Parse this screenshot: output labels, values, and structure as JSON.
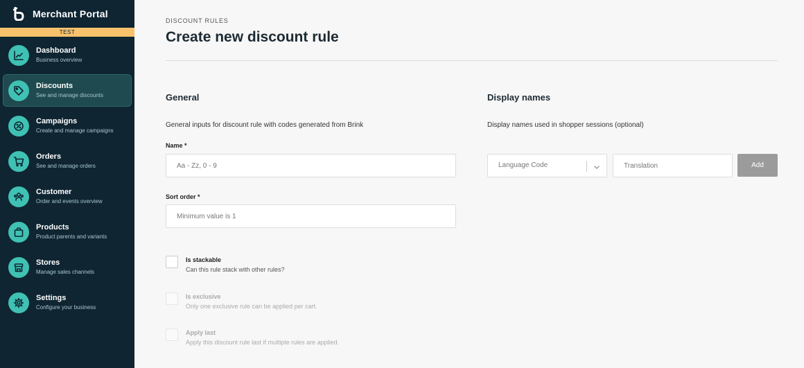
{
  "app": {
    "title": "Merchant Portal",
    "env": "TEST"
  },
  "nav": [
    {
      "label": "Dashboard",
      "sub": "Business overview",
      "icon": "chart-line-icon"
    },
    {
      "label": "Discounts",
      "sub": "See and manage discounts",
      "icon": "tag-icon",
      "active": true
    },
    {
      "label": "Campaigns",
      "sub": "Create and manage campaigns",
      "icon": "badge-percent-icon"
    },
    {
      "label": "Orders",
      "sub": "See and manage orders",
      "icon": "cart-icon"
    },
    {
      "label": "Customer",
      "sub": "Order and events overview",
      "icon": "users-icon"
    },
    {
      "label": "Products",
      "sub": "Product parents and variants",
      "icon": "bag-icon"
    },
    {
      "label": "Stores",
      "sub": "Manage sales channels",
      "icon": "store-icon"
    },
    {
      "label": "Settings",
      "sub": "Configure your business",
      "icon": "gear-icon"
    }
  ],
  "page": {
    "breadcrumb": "DISCOUNT RULES",
    "title": "Create new discount rule"
  },
  "general": {
    "title": "General",
    "desc": "General inputs for discount rule with codes generated from Brink",
    "name_label": "Name *",
    "name_placeholder": "Aa - Zz, 0 - 9",
    "sort_label": "Sort order *",
    "sort_placeholder": "Minimum value is 1",
    "checkboxes": [
      {
        "label": "Is stackable",
        "desc": "Can this rule stack with other rules?",
        "checked": false,
        "disabled": false
      },
      {
        "label": "Is exclusive",
        "desc": "Only one exclusive rule can be applied per cart.",
        "checked": false,
        "disabled": true
      },
      {
        "label": "Apply last",
        "desc": "Apply this discount rule last if multiple rules are applied.",
        "checked": false,
        "disabled": true
      }
    ]
  },
  "display": {
    "title": "Display names",
    "desc": "Display names used in shopper sessions (optional)",
    "language_placeholder": "Language Code",
    "translation_placeholder": "Translation",
    "add_label": "Add"
  },
  "colors": {
    "sidebar": "#0f2532",
    "accent": "#3fc1b3",
    "env_badge": "#f7c26b",
    "add_button": "#9b9b9b"
  }
}
